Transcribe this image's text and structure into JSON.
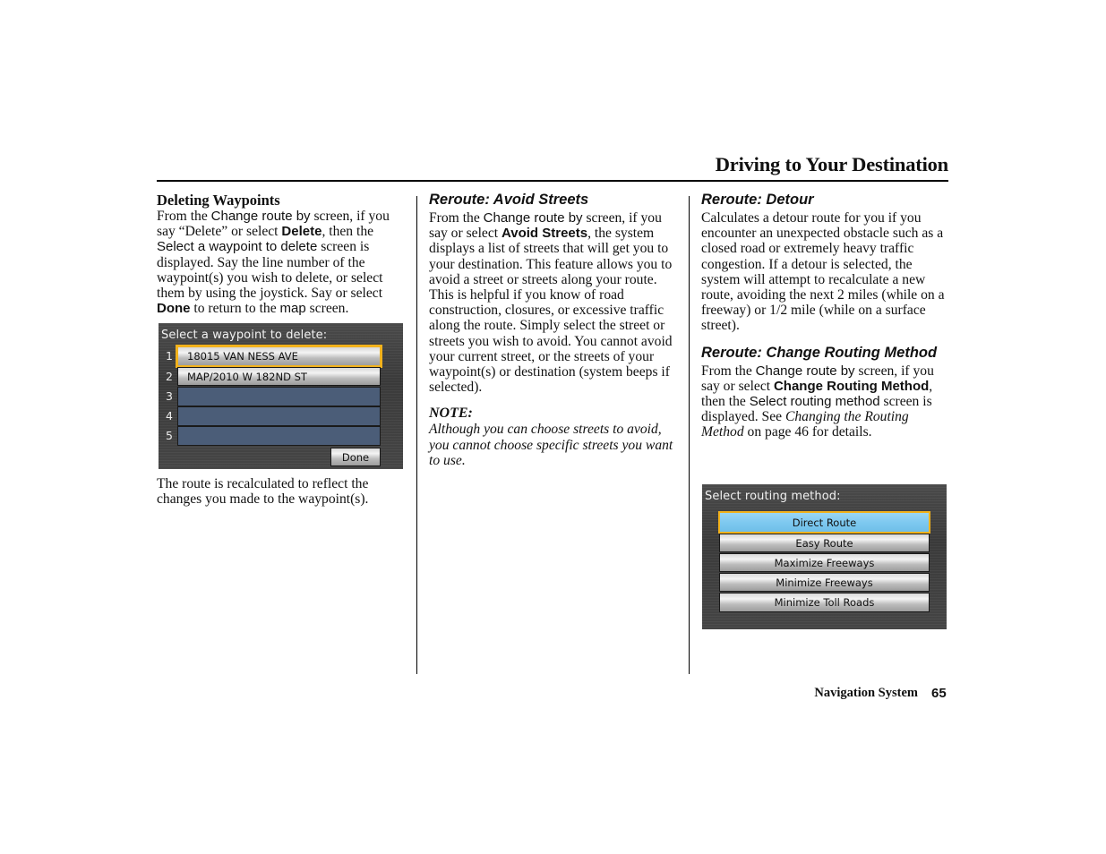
{
  "header": {
    "title": "Driving to Your Destination"
  },
  "col1": {
    "heading": "Deleting Waypoints",
    "para1": {
      "t1": "From the ",
      "ui1": "Change route by",
      "t2": " screen, if you say “Delete” or select ",
      "b1": "Delete",
      "t3": ", then the ",
      "ui2": "Select a waypoint to delete",
      "t4": " screen is displayed. Say the line number of the waypoint(s) you wish to delete, or select them by using the joystick. Say or select ",
      "b2": "Done",
      "t5": " to return to the ",
      "ui3": "map",
      "t6": " screen."
    },
    "screen": {
      "title": "Select a waypoint to delete:",
      "rows": [
        {
          "num": "1",
          "label": "18015 VAN NESS AVE",
          "selected": true
        },
        {
          "num": "2",
          "label": "MAP/2010 W 182ND ST",
          "selected": false
        },
        {
          "num": "3",
          "label": "",
          "selected": false
        },
        {
          "num": "4",
          "label": "",
          "selected": false
        },
        {
          "num": "5",
          "label": "",
          "selected": false
        }
      ],
      "done_label": "Done",
      "highlight_color": "#f2b21c",
      "empty_row_color": "#4b5d78"
    },
    "para2": "The route is recalculated to reflect the changes you made to the waypoint(s)."
  },
  "col2": {
    "heading": "Reroute: Avoid Streets",
    "para1": {
      "t1": "From the ",
      "ui1": "Change route by",
      "t2": " screen, if you say or select ",
      "b1": "Avoid Streets",
      "t3": ", the system displays a list of streets that will get you to your destination. This feature allows you to avoid a street or streets along your route. This is helpful if you know of road construction, closures, or excessive traffic along the route. Simply select the street or streets you wish to avoid. You cannot avoid your current street, or the streets of your waypoint(s) or destination (system beeps if selected)."
    },
    "note_heading": "NOTE:",
    "note_text": "Although you can choose streets to avoid, you cannot choose specific streets you want to use."
  },
  "col3": {
    "heading1": "Reroute: Detour",
    "para1": "Calculates a detour route for you if you encounter an unexpected obstacle such as a closed road or extremely heavy traffic congestion. If a detour is selected, the system will attempt to recalculate a new route, avoiding the next 2 miles (while on a freeway) or 1/2 mile (while on a surface street).",
    "heading2": "Reroute: Change Routing Method",
    "para2": {
      "t1": "From the ",
      "ui1": "Change route by",
      "t2": " screen, if you say or select ",
      "b1": "Change Routing Method",
      "t3": ", then the ",
      "ui2": "Select routing method",
      "t4": " screen is displayed. See ",
      "i1": "Changing the Routing Method",
      "t5": " on page 46 for details."
    },
    "screen": {
      "title": "Select routing method:",
      "options": [
        {
          "label": "Direct Route",
          "selected": true
        },
        {
          "label": "Easy Route",
          "selected": false
        },
        {
          "label": "Maximize Freeways",
          "selected": false
        },
        {
          "label": "Minimize Freeways",
          "selected": false
        },
        {
          "label": "Minimize Toll Roads",
          "selected": false
        }
      ],
      "selected_color": "#7ec9f0",
      "highlight_color": "#f2b21c"
    }
  },
  "footer": {
    "label": "Navigation System",
    "page": "65"
  }
}
